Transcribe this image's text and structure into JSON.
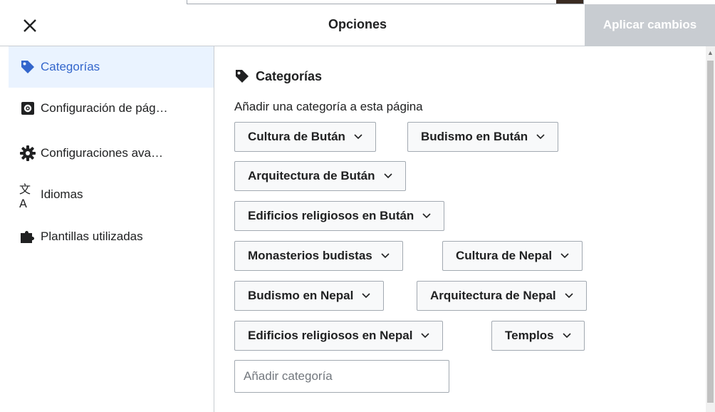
{
  "header": {
    "title": "Opciones",
    "apply_label": "Aplicar cambios"
  },
  "sidebar": {
    "items": [
      {
        "label": "Categorías",
        "icon": "tag-icon",
        "active": true
      },
      {
        "label": "Configuración de pág…",
        "icon": "page-settings-icon",
        "active": false
      },
      {
        "label": "Configuraciones ava…",
        "icon": "gear-icon",
        "active": false
      },
      {
        "label": "Idiomas",
        "icon": "language-icon",
        "active": false
      },
      {
        "label": "Plantillas utilizadas",
        "icon": "puzzle-icon",
        "active": false
      }
    ]
  },
  "main": {
    "section_title": "Categorías",
    "subtitle": "Añadir una categoría a esta página",
    "categories": [
      "Cultura de Bután",
      "Budismo en Bután",
      "Arquitectura de Bután",
      "Edificios religiosos en Bután",
      "Monasterios budistas",
      "Cultura de Nepal",
      "Budismo en Nepal",
      "Arquitectura de Nepal",
      "Edificios religiosos en Nepal",
      "Templos"
    ],
    "add_placeholder": "Añadir categoría",
    "add_value": ""
  },
  "colors": {
    "accent": "#3366cc",
    "active_bg": "#eaf3ff",
    "apply_bg": "#c8ccd1",
    "chip_bg": "#f8f9fa",
    "border": "#a2a9b1"
  }
}
